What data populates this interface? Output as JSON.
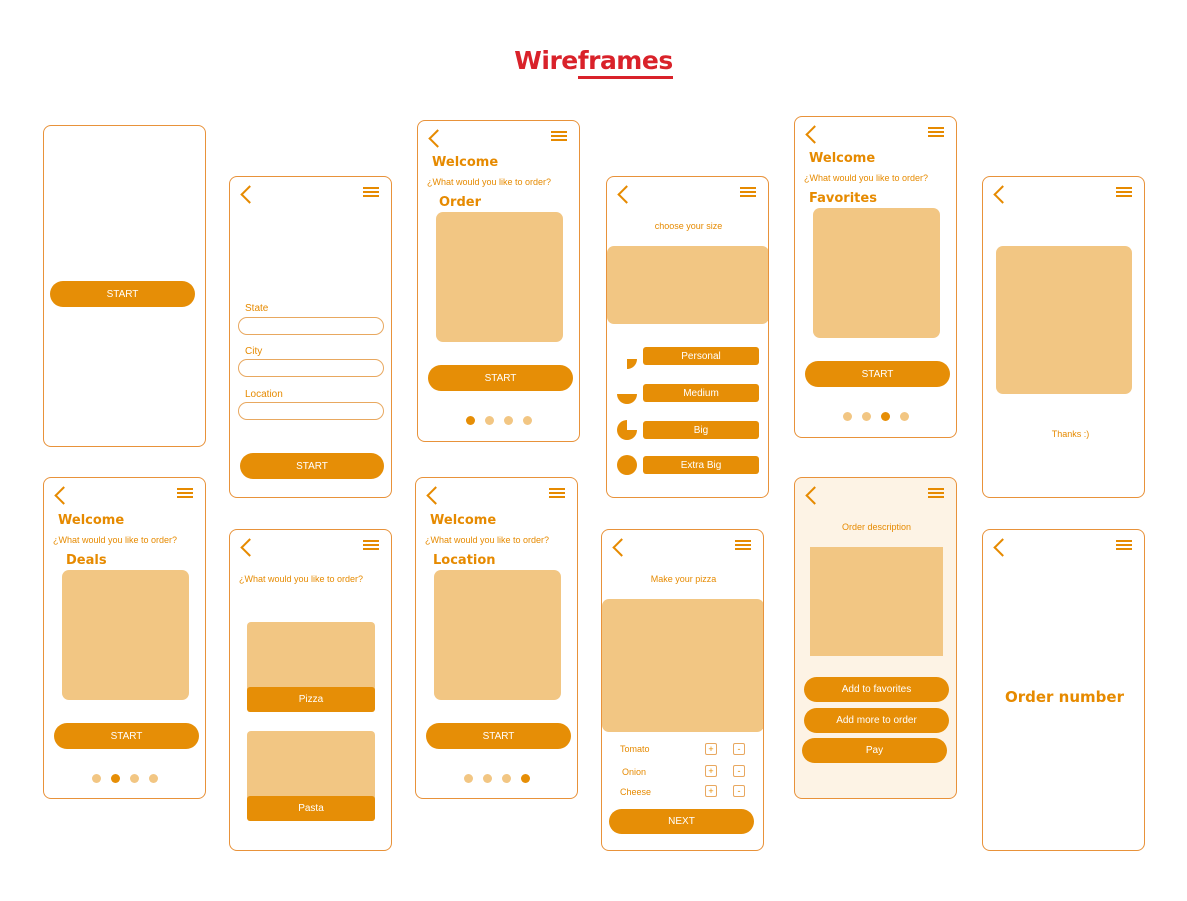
{
  "title": {
    "prefix": "Wire",
    "underlined": "frames"
  },
  "screen_start": {
    "start_label": "START"
  },
  "screen_location_form": {
    "state_label": "State",
    "city_label": "City",
    "location_label": "Location",
    "start_label": "START"
  },
  "screen_order": {
    "welcome": "Welcome",
    "question": "¿What would you like to order?",
    "section": "Order",
    "start_label": "START",
    "active_dot": 1,
    "dot_count": 4
  },
  "screen_size": {
    "prompt": "choose your size",
    "sizes": [
      "Personal",
      "Medium",
      "Big",
      "Extra Big"
    ]
  },
  "screen_favorites": {
    "welcome": "Welcome",
    "question": "¿What would you like to order?",
    "section": "Favorites",
    "start_label": "START",
    "active_dot": 3,
    "dot_count": 4
  },
  "screen_thanks": {
    "message": "Thanks :)"
  },
  "screen_deals": {
    "welcome": "Welcome",
    "question": "¿What would you like to order?",
    "section": "Deals",
    "start_label": "START",
    "active_dot": 2,
    "dot_count": 4
  },
  "screen_menu_choice": {
    "question": "¿What would you like to order?",
    "option_1": "Pizza",
    "option_2": "Pasta"
  },
  "screen_location": {
    "welcome": "Welcome",
    "question": "¿What would you like to order?",
    "section": "Location",
    "start_label": "START",
    "active_dot": 4,
    "dot_count": 4
  },
  "screen_make_pizza": {
    "prompt": "Make your pizza",
    "ingredients": [
      "Tomato",
      "Onion",
      "Cheese"
    ],
    "plus": "+",
    "minus": "-",
    "next_label": "NEXT"
  },
  "screen_order_description": {
    "prompt": "Order description",
    "add_favorites": "Add to favorites",
    "add_more": "Add more to order",
    "pay": "Pay"
  },
  "screen_order_number": {
    "label": "Order number"
  },
  "colors": {
    "accent": "#e68e06",
    "light": "#f2c683",
    "border": "#e8923a",
    "title_red": "#d9222a",
    "tint": "#fdf3e5"
  }
}
